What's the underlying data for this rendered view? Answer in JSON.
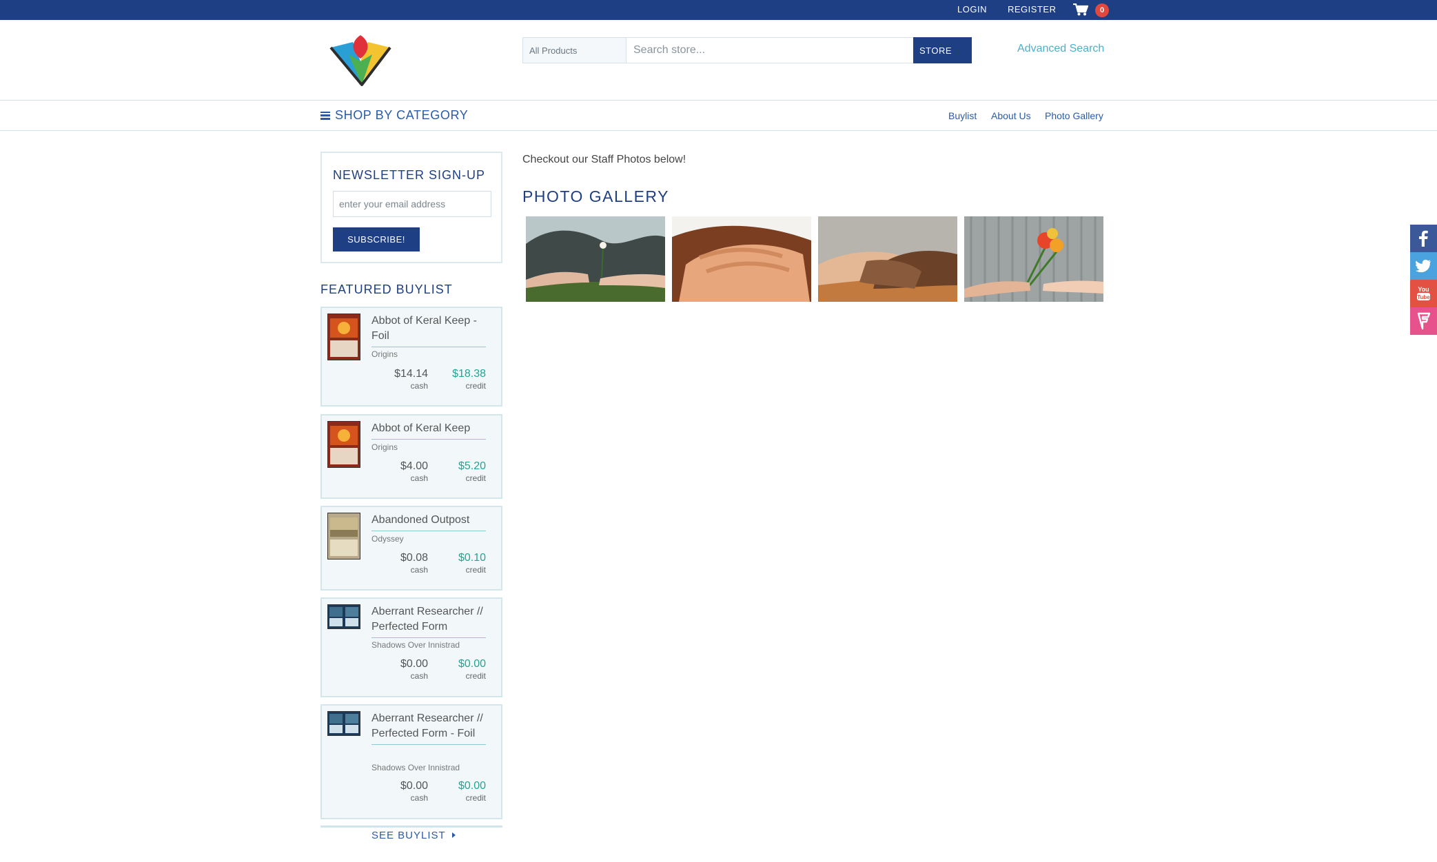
{
  "topbar": {
    "login": "LOGIN",
    "register": "REGISTER",
    "cart_count": "0"
  },
  "header": {
    "search_category": "All Products",
    "search_placeholder": "Search store...",
    "search_button": "STORE",
    "advanced_search": "Advanced Search"
  },
  "nav": {
    "shop_by_category": "SHOP BY CATEGORY",
    "links": [
      "Buylist",
      "About Us",
      "Photo Gallery"
    ]
  },
  "newsletter": {
    "title": "NEWSLETTER SIGN-UP",
    "email_placeholder": "enter your email address",
    "subscribe": "SUBSCRIBE!"
  },
  "featured_buylist": {
    "title": "FEATURED BUYLIST",
    "items": [
      {
        "name": "Abbot of Keral Keep - Foil",
        "set": "Origins",
        "cash": "$14.14",
        "credit": "$18.38",
        "cash_label": "cash",
        "credit_label": "credit"
      },
      {
        "name": "Abbot of Keral Keep",
        "set": "Origins",
        "cash": "$4.00",
        "credit": "$5.20",
        "cash_label": "cash",
        "credit_label": "credit"
      },
      {
        "name": "Abandoned Outpost",
        "set": "Odyssey",
        "cash": "$0.08",
        "credit": "$0.10",
        "cash_label": "cash",
        "credit_label": "credit"
      },
      {
        "name": "Aberrant Researcher // Perfected Form",
        "set": "Shadows Over Innistrad",
        "cash": "$0.00",
        "credit": "$0.00",
        "cash_label": "cash",
        "credit_label": "credit"
      },
      {
        "name": "Aberrant Researcher // Perfected Form - Foil",
        "set": "Shadows Over Innistrad",
        "cash": "$0.00",
        "credit": "$0.00",
        "cash_label": "cash",
        "credit_label": "credit"
      }
    ],
    "see_buylist": "SEE BUYLIST"
  },
  "main": {
    "intro": "Checkout our Staff Photos below!",
    "gallery_title": "PHOTO GALLERY"
  },
  "social": [
    "facebook-icon",
    "twitter-icon",
    "youtube-icon",
    "foursquare-icon"
  ],
  "colors": {
    "brand_navy": "#1e3f84",
    "link_blue": "#2a5ba6",
    "accent_teal": "#4cb0c8",
    "credit_green": "#23a393",
    "facebook": "#3b5998",
    "twitter": "#4aa3df",
    "youtube": "#e25141",
    "foursquare": "#e8528c"
  }
}
